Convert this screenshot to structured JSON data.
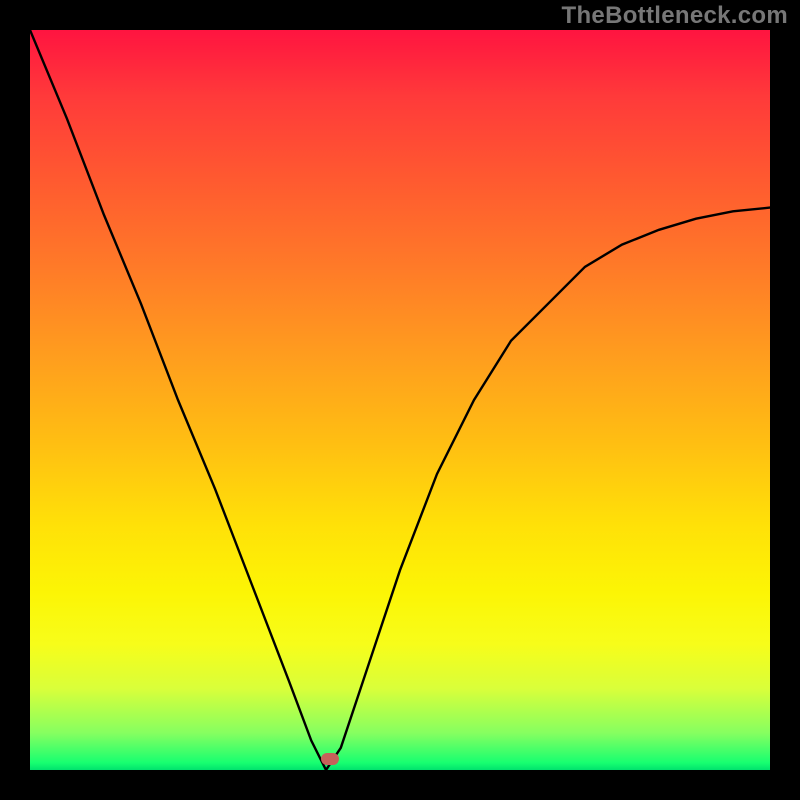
{
  "watermark": "TheBottleneck.com",
  "chart_data": {
    "type": "line",
    "title": "",
    "xlabel": "",
    "ylabel": "",
    "xlim": [
      0,
      100
    ],
    "ylim": [
      0,
      100
    ],
    "background": "rainbow-vertical (red top, green bottom)",
    "marker": {
      "x": 40.5,
      "y": 1.5,
      "color_hex": "#c6615a"
    },
    "series": [
      {
        "name": "bottleneck-curve",
        "x": [
          0,
          5,
          10,
          15,
          20,
          25,
          30,
          35,
          38,
          40,
          42,
          45,
          50,
          55,
          60,
          65,
          70,
          75,
          80,
          85,
          90,
          95,
          100
        ],
        "y": [
          100,
          88,
          75,
          63,
          50,
          38,
          25,
          12,
          4,
          0,
          3,
          12,
          27,
          40,
          50,
          58,
          63,
          68,
          71,
          73,
          74.5,
          75.5,
          76
        ]
      }
    ]
  },
  "colors": {
    "watermark": "#777777",
    "frame": "#000000",
    "curve": "#000000",
    "marker": "#c6615a"
  }
}
